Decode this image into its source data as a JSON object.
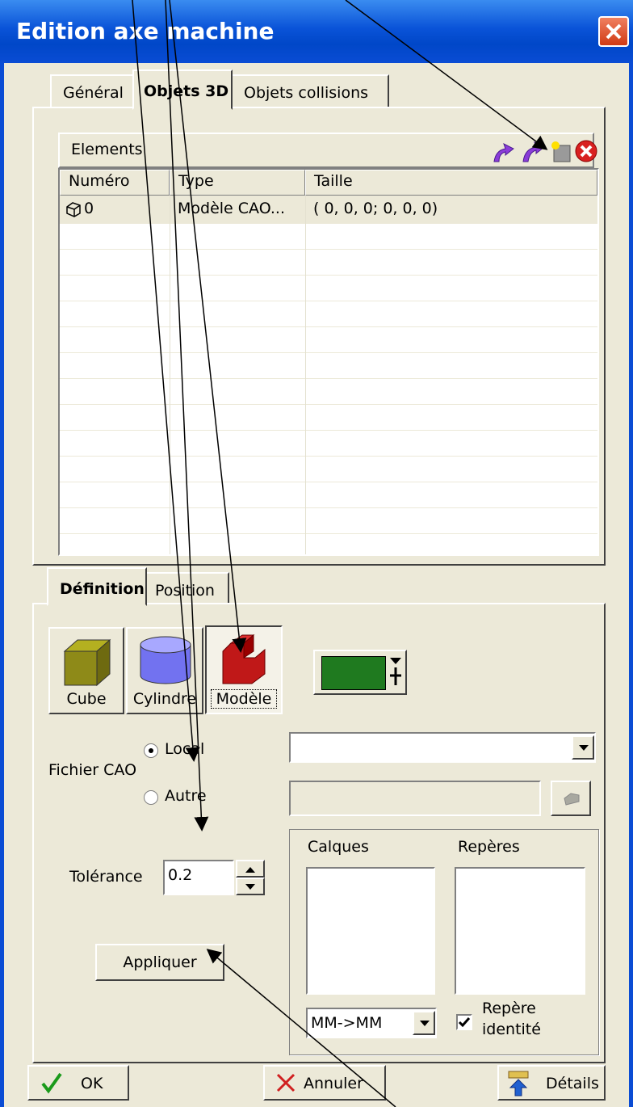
{
  "window": {
    "title": "Edition axe machine"
  },
  "tabs": [
    "Général",
    "Objets 3D",
    "Objets collisions"
  ],
  "elements": {
    "title": "Elements",
    "columns": [
      "Numéro",
      "Type",
      "Taille"
    ],
    "rows": [
      {
        "numero": "0",
        "type": "Modèle CAO...",
        "taille": "( 0, 0, 0; 0, 0, 0)"
      }
    ]
  },
  "subtabs": [
    "Définition",
    "Position"
  ],
  "shapes": [
    "Cube",
    "Cylindre",
    "Modèle"
  ],
  "color": "#1f7a1f",
  "cao": {
    "label": "Fichier CAO",
    "local": "Local",
    "autre": "Autre",
    "local_value": "",
    "autre_value": ""
  },
  "tolerance": {
    "label": "Tolérance",
    "value": "0.2"
  },
  "apply": "Appliquer",
  "lists": {
    "calques": "Calques",
    "reperes": "Repères"
  },
  "units": "MM->MM",
  "identity": {
    "line1": "Repère",
    "line2": "identité"
  },
  "footer": {
    "ok": "OK",
    "cancel": "Annuler",
    "details": "Détails"
  }
}
